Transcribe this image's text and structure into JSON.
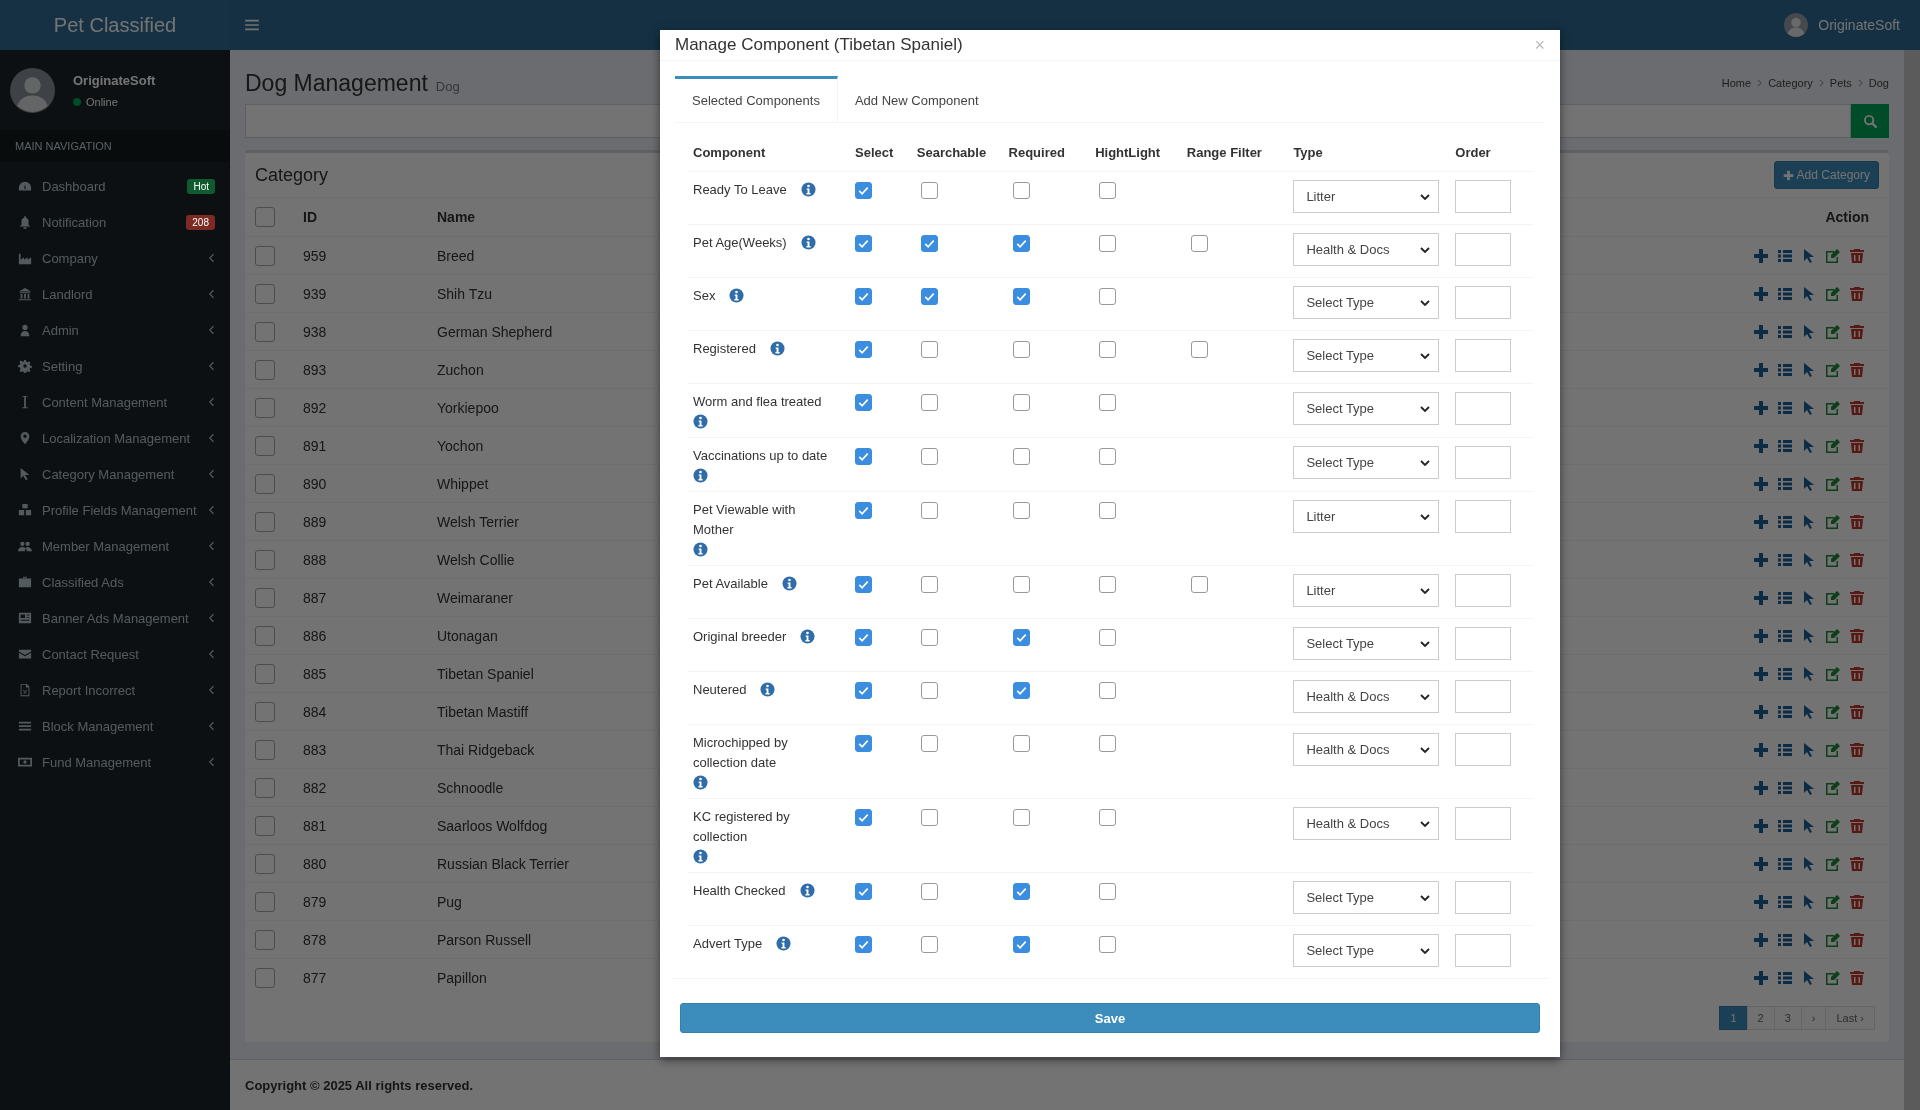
{
  "app": {
    "logo": "Pet Classified",
    "user_name": "OriginateSoft"
  },
  "sidebar": {
    "user": {
      "name": "OriginateSoft",
      "status": "Online"
    },
    "section": "MAIN NAVIGATION",
    "items": [
      {
        "label": "Dashboard",
        "badge": {
          "text": "Hot",
          "color": "#0f5a2f"
        }
      },
      {
        "label": "Notification",
        "badge": {
          "text": "208",
          "color": "#7c2a22"
        }
      },
      {
        "label": "Company",
        "expanded": false
      },
      {
        "label": "Landlord",
        "expanded": false
      },
      {
        "label": "Admin",
        "expanded": false
      },
      {
        "label": "Setting",
        "expanded": false
      },
      {
        "label": "Content Management",
        "expanded": false
      },
      {
        "label": "Localization Management",
        "expanded": false
      },
      {
        "label": "Category Management",
        "expanded": false
      },
      {
        "label": "Profile Fields Management",
        "expanded": false
      },
      {
        "label": "Member Management",
        "expanded": false
      },
      {
        "label": "Classified Ads",
        "expanded": false
      },
      {
        "label": "Banner Ads Management",
        "expanded": false
      },
      {
        "label": "Contact Request",
        "expanded": false
      },
      {
        "label": "Report Incorrect",
        "expanded": false
      },
      {
        "label": "Block Management",
        "expanded": false
      },
      {
        "label": "Fund Management",
        "expanded": false
      }
    ]
  },
  "page": {
    "title": "Dog Management",
    "subtitle": "Dog",
    "breadcrumb": [
      "Home",
      "Category",
      "Pets",
      "Dog"
    ]
  },
  "category": {
    "title": "Category",
    "add_button": "Add Category",
    "select_all_checked": false,
    "columns": [
      "ID",
      "Name",
      "Action"
    ],
    "rows": [
      {
        "id": "959",
        "name": "Breed",
        "checked": false
      },
      {
        "id": "939",
        "name": "Shih Tzu",
        "checked": false
      },
      {
        "id": "938",
        "name": "German Shepherd",
        "checked": false
      },
      {
        "id": "893",
        "name": "Zuchon",
        "checked": false
      },
      {
        "id": "892",
        "name": "Yorkiepoo",
        "checked": false
      },
      {
        "id": "891",
        "name": "Yochon",
        "checked": false
      },
      {
        "id": "890",
        "name": "Whippet",
        "checked": false
      },
      {
        "id": "889",
        "name": "Welsh Terrier",
        "checked": false
      },
      {
        "id": "888",
        "name": "Welsh Collie",
        "checked": false
      },
      {
        "id": "887",
        "name": "Weimaraner",
        "checked": false
      },
      {
        "id": "886",
        "name": "Utonagan",
        "checked": false
      },
      {
        "id": "885",
        "name": "Tibetan Spaniel",
        "checked": false
      },
      {
        "id": "884",
        "name": "Tibetan Mastiff",
        "checked": false
      },
      {
        "id": "883",
        "name": "Thai Ridgeback",
        "checked": false
      },
      {
        "id": "882",
        "name": "Schnoodle",
        "checked": false
      },
      {
        "id": "881",
        "name": "Saarloos Wolfdog",
        "checked": false
      },
      {
        "id": "880",
        "name": "Russian Black Terrier",
        "checked": false
      },
      {
        "id": "879",
        "name": "Pug",
        "checked": false
      },
      {
        "id": "878",
        "name": "Parson Russell",
        "checked": false
      },
      {
        "id": "877",
        "name": "Papillon",
        "checked": false
      }
    ],
    "pagination": [
      {
        "label": "1",
        "selected": true
      },
      {
        "label": "2",
        "selected": false
      },
      {
        "label": "3",
        "selected": false
      },
      {
        "label": "›",
        "selected": false
      },
      {
        "label": "Last ›",
        "selected": false
      }
    ]
  },
  "footer": "Copyright © 2025 All rights reserved.",
  "modal": {
    "title": "Manage Component (Tibetan Spaniel)",
    "close": "×",
    "tabs": [
      {
        "label": "Selected Components",
        "selected": true
      },
      {
        "label": "Add New Component",
        "selected": false
      }
    ],
    "columns": [
      "Component",
      "Select",
      "Searchable",
      "Required",
      "HightLight",
      "Range Filter",
      "Type",
      "Order"
    ],
    "rows": [
      {
        "name": "Ready To Leave",
        "select": true,
        "searchable": false,
        "required": false,
        "highlight": false,
        "type": "Litter"
      },
      {
        "name": "Pet Age(Weeks)",
        "select": true,
        "searchable": true,
        "required": true,
        "highlight": false,
        "range_filter": false,
        "type": "Health & Docs"
      },
      {
        "name": "Sex",
        "select": true,
        "searchable": true,
        "required": true,
        "highlight": false,
        "type": "Select Type"
      },
      {
        "name": "Registered",
        "select": true,
        "searchable": false,
        "required": false,
        "highlight": false,
        "range_filter": false,
        "type": "Select Type"
      },
      {
        "name": "Worm and flea treated",
        "select": true,
        "searchable": false,
        "required": false,
        "highlight": false,
        "type": "Select Type"
      },
      {
        "name": "Vaccinations up to date",
        "select": true,
        "searchable": false,
        "required": false,
        "highlight": false,
        "type": "Select Type"
      },
      {
        "name": "Pet Viewable with Mother",
        "select": true,
        "searchable": false,
        "required": false,
        "highlight": false,
        "type": "Litter"
      },
      {
        "name": "Pet Available",
        "select": true,
        "searchable": false,
        "required": false,
        "highlight": false,
        "range_filter": false,
        "type": "Litter"
      },
      {
        "name": "Original breeder",
        "select": true,
        "searchable": false,
        "required": true,
        "highlight": false,
        "type": "Select Type"
      },
      {
        "name": "Neutered",
        "select": true,
        "searchable": false,
        "required": true,
        "highlight": false,
        "type": "Health & Docs"
      },
      {
        "name": "Microchipped by collection date",
        "select": true,
        "searchable": false,
        "required": false,
        "highlight": false,
        "type": "Health & Docs"
      },
      {
        "name": "KC registered by collection",
        "select": true,
        "searchable": false,
        "required": false,
        "highlight": false,
        "type": "Health & Docs"
      },
      {
        "name": "Health Checked",
        "select": true,
        "searchable": false,
        "required": true,
        "highlight": false,
        "type": "Select Type"
      },
      {
        "name": "Advert Type",
        "select": true,
        "searchable": false,
        "required": true,
        "highlight": false,
        "type": "Select Type"
      }
    ],
    "save_button": "Save"
  }
}
